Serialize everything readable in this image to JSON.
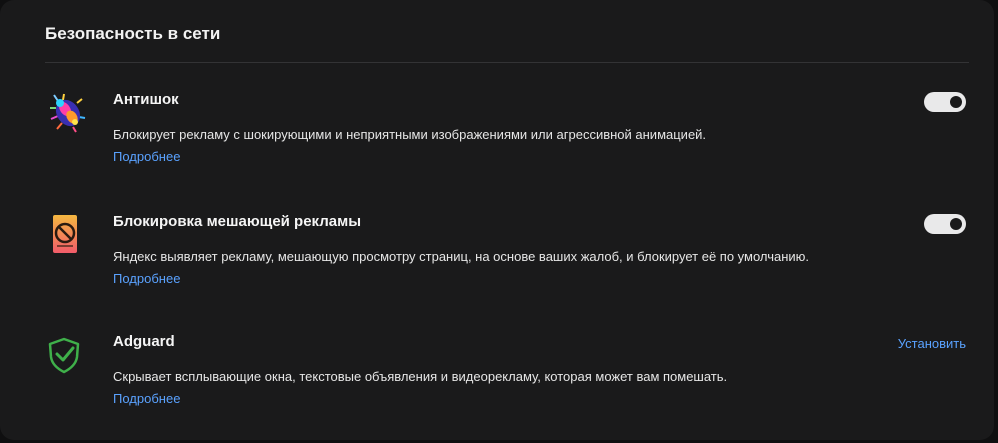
{
  "section": {
    "title": "Безопасность в сети"
  },
  "extensions": [
    {
      "title": "Антишок",
      "description": "Блокирует рекламу с шокирующими и неприятными изображениями или агрессивной анимацией.",
      "more": "Подробнее",
      "icon": "bug-icon",
      "enabled": true
    },
    {
      "title": "Блокировка мешающей рекламы",
      "description": "Яндекс выявляет рекламу, мешающую просмотру страниц, на основе ваших жалоб, и блокирует её по умолчанию.",
      "more": "Подробнее",
      "icon": "blocked-ad-icon",
      "enabled": true
    },
    {
      "title": "Adguard",
      "description": "Скрывает всплывающие окна, текстовые объявления и видеорекламу, которая может вам помешать.",
      "more": "Подробнее",
      "icon": "shield-check-icon",
      "action": "Установить"
    }
  ],
  "colors": {
    "background": "#1a1a1b",
    "link": "#5aa2ff",
    "toggle_on": "#e9e9ea",
    "adguard_green": "#3fb04a"
  }
}
